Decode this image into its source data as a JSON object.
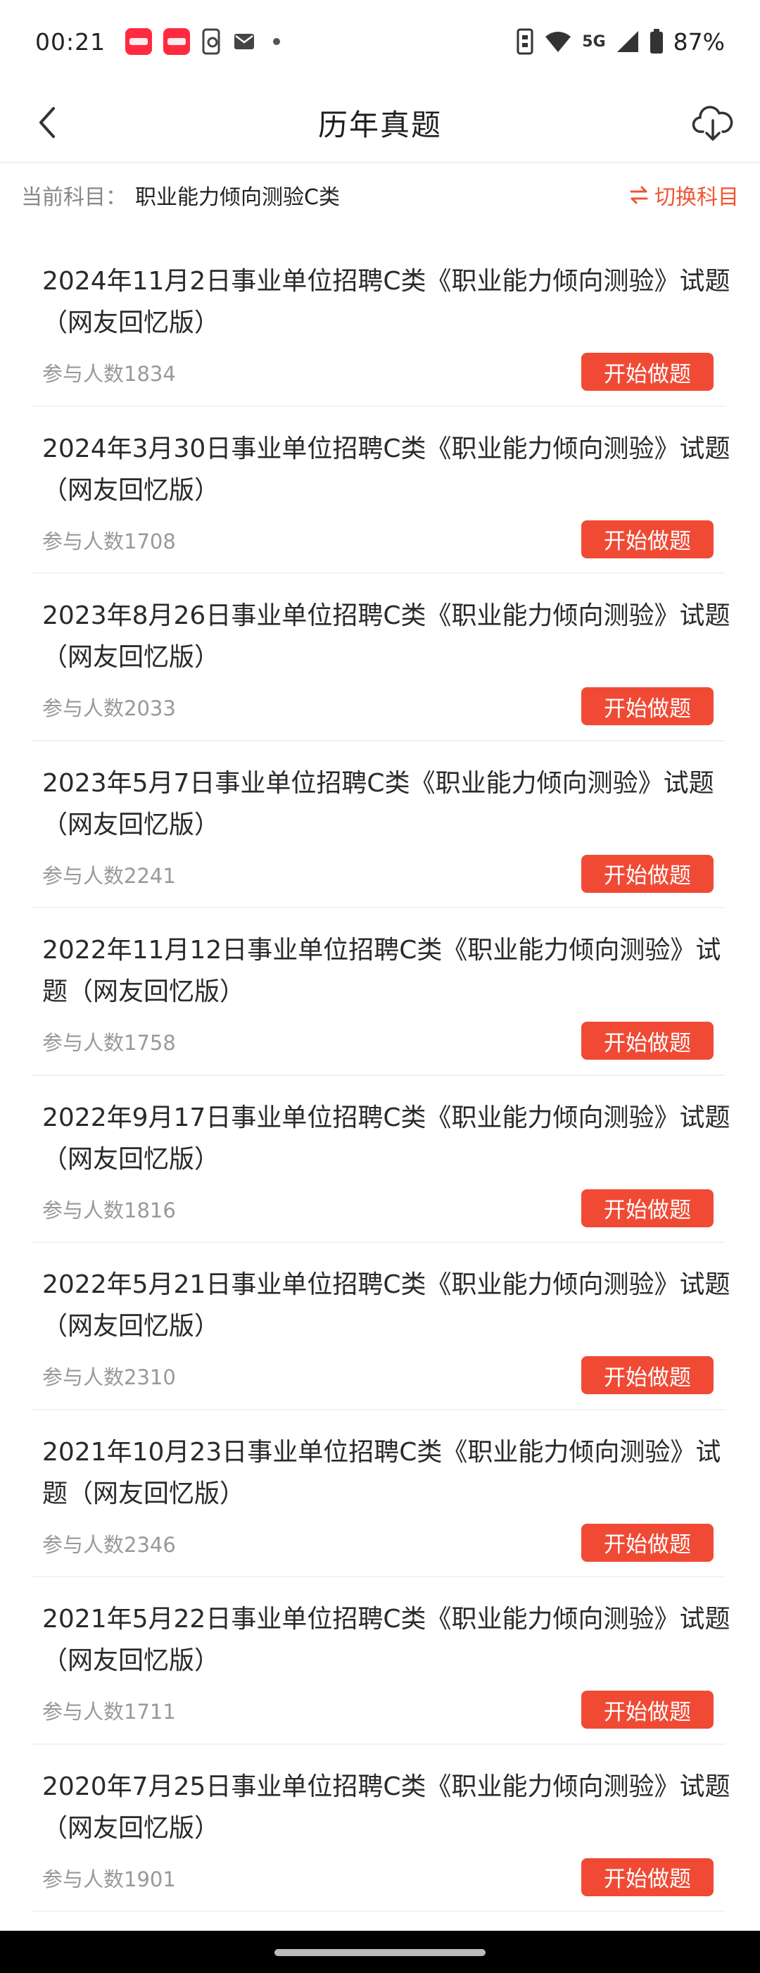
{
  "status_bar": {
    "time": "00:21",
    "network": "5G",
    "battery": "87%",
    "notification_icons": [
      "red-app-icon",
      "red-app-icon",
      "phone-sync-icon",
      "mail-icon",
      "dot-icon"
    ],
    "system_icons": [
      "vibrate-icon",
      "wifi-icon",
      "signal-icon",
      "battery-icon"
    ]
  },
  "header": {
    "title": "历年真题",
    "back_icon": "chevron-left-icon",
    "download_icon": "cloud-download-icon"
  },
  "subject": {
    "label": "当前科目：",
    "value": "职业能力倾向测验C类",
    "switch_label": "切换科目",
    "switch_icon": "swap-arrows-icon",
    "accent_color": "#f05532"
  },
  "exams": [
    {
      "title": "2024年11月2日事业单位招聘C类《职业能力倾向测验》试题（网友回忆版）",
      "count": "参与人数1834",
      "button": "开始做题"
    },
    {
      "title": "2024年3月30日事业单位招聘C类《职业能力倾向测验》试题（网友回忆版）",
      "count": "参与人数1708",
      "button": "开始做题"
    },
    {
      "title": "2023年8月26日事业单位招聘C类《职业能力倾向测验》试题（网友回忆版）",
      "count": "参与人数2033",
      "button": "开始做题"
    },
    {
      "title": "2023年5月7日事业单位招聘C类《职业能力倾向测验》试题（网友回忆版）",
      "count": "参与人数2241",
      "button": "开始做题"
    },
    {
      "title": "2022年11月12日事业单位招聘C类《职业能力倾向测验》试题（网友回忆版）",
      "count": "参与人数1758",
      "button": "开始做题"
    },
    {
      "title": "2022年9月17日事业单位招聘C类《职业能力倾向测验》试题（网友回忆版）",
      "count": "参与人数1816",
      "button": "开始做题"
    },
    {
      "title": "2022年5月21日事业单位招聘C类《职业能力倾向测验》试题（网友回忆版）",
      "count": "参与人数2310",
      "button": "开始做题"
    },
    {
      "title": "2021年10月23日事业单位招聘C类《职业能力倾向测验》试题（网友回忆版）",
      "count": "参与人数2346",
      "button": "开始做题"
    },
    {
      "title": "2021年5月22日事业单位招聘C类《职业能力倾向测验》试题（网友回忆版）",
      "count": "参与人数1711",
      "button": "开始做题"
    },
    {
      "title": "2020年7月25日事业单位招聘C类《职业能力倾向测验》试题（网友回忆版）",
      "count": "参与人数1901",
      "button": "开始做题"
    }
  ],
  "colors": {
    "button_bg": "#f04a35",
    "button_text": "#ffffff",
    "muted_text": "#999999"
  }
}
